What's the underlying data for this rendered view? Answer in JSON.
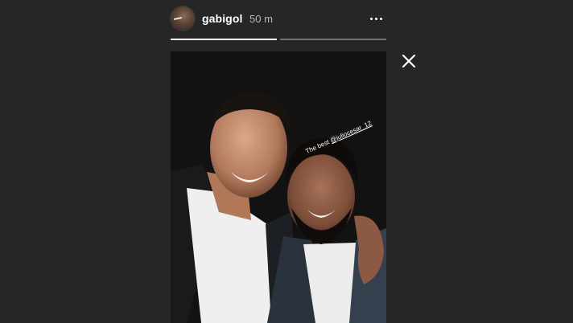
{
  "header": {
    "username": "gabigol",
    "time": "50 m",
    "more_icon": "more-horizontal-icon"
  },
  "progress": {
    "segments": 2,
    "active_index": 0,
    "active_fraction": 1.0
  },
  "close_icon": "close-icon",
  "story": {
    "caption_text": "The best ",
    "caption_mention": "@juliocesar_12"
  },
  "colors": {
    "background": "#262626",
    "text": "#ffffff",
    "muted": "#b8b8b8"
  }
}
